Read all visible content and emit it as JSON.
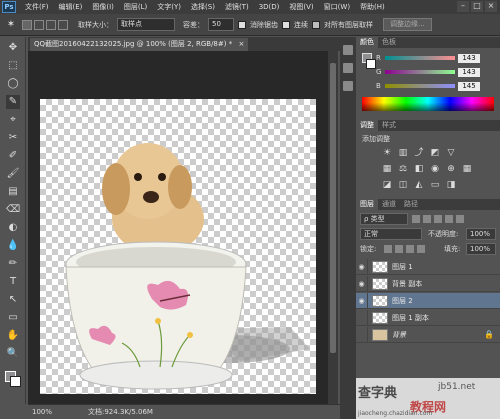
{
  "app": {
    "logo": "Ps"
  },
  "menu": [
    "文件(F)",
    "编辑(E)",
    "图像(I)",
    "图层(L)",
    "文字(Y)",
    "选择(S)",
    "滤镜(T)",
    "3D(D)",
    "视图(V)",
    "窗口(W)",
    "帮助(H)"
  ],
  "window_controls": [
    "–",
    "□",
    "×"
  ],
  "options": {
    "sample_size_label": "取样大小：",
    "sample_size_value": "取样点",
    "tolerance_label": "容差：",
    "tolerance_value": "50",
    "antialias_label": "消除锯齿",
    "contiguous_label": "连续",
    "all_layers_label": "对所有图层取样",
    "refine_edge_button": "调整边缘..."
  },
  "document": {
    "tab_title": "QQ截图20160422132025.jpg @ 100% (图层 2, RGB/8#) *",
    "tab_close": "×",
    "zoom": "100%",
    "doc_info": "文档:924.3K/5.06M"
  },
  "tools": [
    "✥",
    "⬚",
    "◯",
    "✎",
    "⌖",
    "✂",
    "✐",
    "🖌",
    "▤",
    "⌫",
    "◐",
    "💧",
    "✏",
    "T",
    "↖",
    "▭",
    "✋",
    "🔍"
  ],
  "color_panel": {
    "tabs": [
      "颜色",
      "色板"
    ],
    "R_label": "R",
    "R_value": "143",
    "G_label": "G",
    "G_value": "143",
    "B_label": "B",
    "B_value": "145",
    "foreground_color": "#8f8f91"
  },
  "adjustments_panel": {
    "tabs": [
      "调整",
      "样式"
    ],
    "title": "添加调整"
  },
  "layers_panel": {
    "tabs": [
      "图层",
      "通道",
      "路径"
    ],
    "kind_label": "ρ 类型",
    "blend_mode": "正常",
    "opacity_label": "不透明度:",
    "opacity_value": "100%",
    "lock_label": "锁定:",
    "fill_label": "填充:",
    "fill_value": "100%",
    "layers": [
      {
        "name": "图层 1",
        "visible": true,
        "selected": false
      },
      {
        "name": "背景 副本",
        "visible": true,
        "selected": false
      },
      {
        "name": "图层 2",
        "visible": true,
        "selected": true
      },
      {
        "name": "图层 1 副本",
        "visible": false,
        "selected": false
      },
      {
        "name": "背景",
        "visible": false,
        "selected": false
      }
    ]
  },
  "watermark": {
    "line1": "查字典",
    "line2": "教程网",
    "url": "jiaocheng.chazidian.com",
    "site": "jb51.net"
  }
}
